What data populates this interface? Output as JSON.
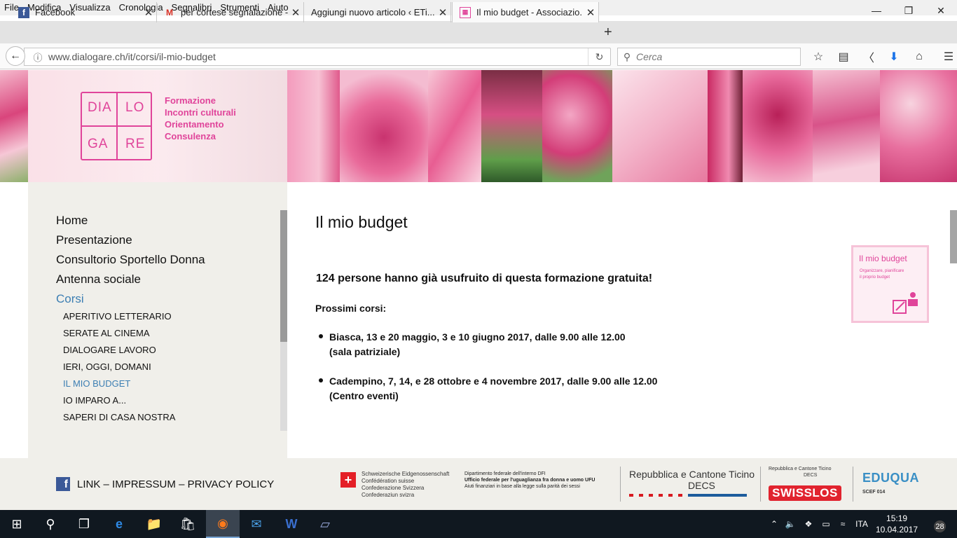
{
  "menubar": {
    "items": [
      "File",
      "Modifica",
      "Visualizza",
      "Cronologia",
      "Segnalibri",
      "Strumenti",
      "Aiuto"
    ]
  },
  "tabs": [
    {
      "title": "Facebook",
      "icon": "facebook-icon"
    },
    {
      "title": "per cortese segnalazione -...",
      "icon": "gmail-icon"
    },
    {
      "title": "Aggiungi nuovo articolo ‹ ETi...",
      "icon": "wordpress-icon"
    },
    {
      "title": "Il mio budget - Associazio...",
      "icon": "site-logo-icon"
    }
  ],
  "navbar": {
    "url": "www.dialogare.ch/it/corsi/il-mio-budget",
    "search_placeholder": "Cerca"
  },
  "logo": {
    "cells": [
      "DIA",
      "LO",
      "GA",
      "RE"
    ],
    "tagline": [
      "Formazione",
      "Incontri culturali",
      "Orientamento",
      "Consulenza"
    ]
  },
  "sidebar": {
    "main": [
      "Home",
      "Presentazione",
      "Consultorio Sportello Donna",
      "Antenna sociale",
      "Corsi"
    ],
    "active_main": "Corsi",
    "sub": [
      "APERITIVO LETTERARIO",
      "SERATE AL CINEMA",
      "DIALOGARE LAVORO",
      "IERI, OGGI, DOMANI",
      "IL MIO BUDGET",
      "IO IMPARO A...",
      "SAPERI DI CASA NOSTRA"
    ],
    "active_sub": "IL MIO BUDGET"
  },
  "main": {
    "title": "Il mio budget",
    "lead": "124 persone hanno già usufruito di questa formazione gratuita!",
    "next_heading": "Prossimi corsi:",
    "courses": [
      {
        "line1": "Biasca, 13 e 20 maggio, 3 e 10 giugno 2017, dalle 9.00 alle 12.00",
        "line2": "(sala patriziale)"
      },
      {
        "line1": "Cadempino,  7, 14, e 28 ottobre e 4 novembre 2017, dalle 9.00 alle 12.00",
        "line2": "(Centro eventi)"
      }
    ],
    "card": {
      "title": "Il mio budget",
      "subtitle": [
        "Organizzare, pianificare",
        "il proprio budget"
      ]
    }
  },
  "footer": {
    "links": [
      "LINK",
      "IMPRESSUM",
      "PRIVACY POLICY"
    ],
    "separator": "–",
    "confederation": [
      "Schweizerische Eidgenossenschaft",
      "Confédération suisse",
      "Confederazione Svizzera",
      "Confederaziun svizra"
    ],
    "dfi": [
      "Dipartimento federale dell'interno DFI",
      "Ufficio federale per l'uguaglianza fra donna e uomo UFU",
      "Aiuti finanziari in base alla legge sulla parità dei sessi"
    ],
    "ticino": [
      "Repubblica  e  Cantone Ticino",
      "DECS"
    ],
    "swisslos_top": [
      "Repubblica  e  Cantone Ticino",
      "DECS"
    ],
    "swisslos": "SWISSLOS",
    "eduqua": "EDUQUA",
    "eduqua_code": "SCEF 014"
  },
  "taskbar": {
    "language": "ITA",
    "time": "15:19",
    "date": "10.04.2017",
    "notifications": "28"
  },
  "colors": {
    "brand_pink": "#e0449a",
    "active_link": "#3d7fb3",
    "sidebar_bg": "#f0efea"
  }
}
